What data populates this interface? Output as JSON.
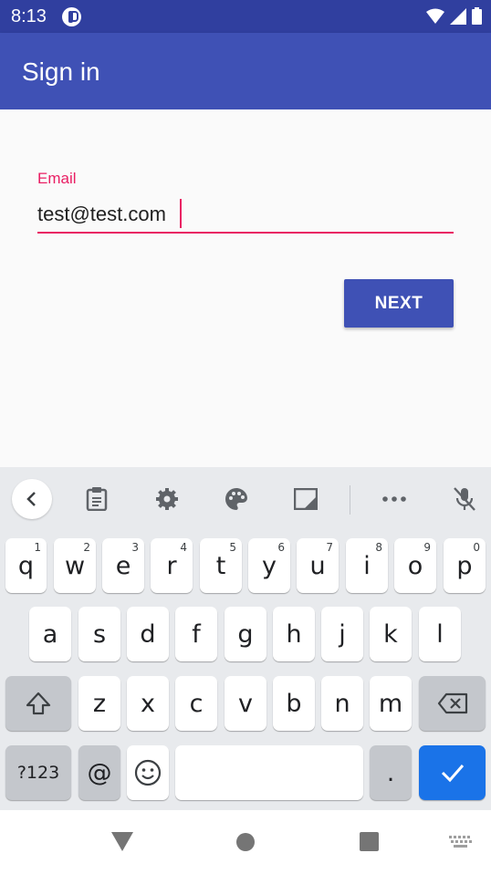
{
  "status_bar": {
    "time": "8:13"
  },
  "app_bar": {
    "title": "Sign in"
  },
  "form": {
    "email_label": "Email",
    "email_value": "test@test.com",
    "next_label": "NEXT"
  },
  "colors": {
    "primary": "#3f51b5",
    "primary_dark": "#303f9f",
    "accent": "#e91e63",
    "keyboard_blue": "#1a73e8"
  },
  "keyboard": {
    "toolbar_icons": [
      "chevron-left-icon",
      "clipboard-icon",
      "settings-icon",
      "palette-icon",
      "resize-icon",
      "more-icon",
      "mic-off-icon"
    ],
    "row1": [
      {
        "label": "q",
        "hint": "1"
      },
      {
        "label": "w",
        "hint": "2"
      },
      {
        "label": "e",
        "hint": "3"
      },
      {
        "label": "r",
        "hint": "4"
      },
      {
        "label": "t",
        "hint": "5"
      },
      {
        "label": "y",
        "hint": "6"
      },
      {
        "label": "u",
        "hint": "7"
      },
      {
        "label": "i",
        "hint": "8"
      },
      {
        "label": "o",
        "hint": "9"
      },
      {
        "label": "p",
        "hint": "0"
      }
    ],
    "row2": [
      "a",
      "s",
      "d",
      "f",
      "g",
      "h",
      "j",
      "k",
      "l"
    ],
    "row3": [
      "z",
      "x",
      "c",
      "v",
      "b",
      "n",
      "m"
    ],
    "symbols_label": "?123",
    "at_label": "@",
    "period_label": "."
  }
}
